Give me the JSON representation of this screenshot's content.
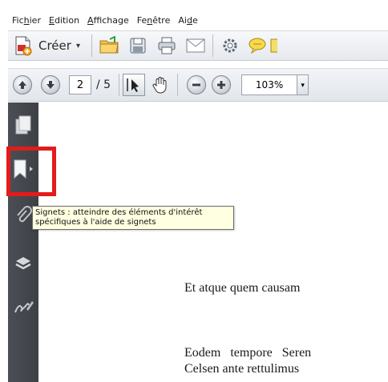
{
  "menu": {
    "items": [
      {
        "label_pre": "Fic",
        "label_u": "h",
        "label_post": "ier"
      },
      {
        "label_pre": "",
        "label_u": "E",
        "label_post": "dition"
      },
      {
        "label_pre": "",
        "label_u": "A",
        "label_post": "ffichage"
      },
      {
        "label_pre": "Fe",
        "label_u": "n",
        "label_post": "être"
      },
      {
        "label_pre": "Ai",
        "label_u": "d",
        "label_post": "e"
      }
    ]
  },
  "toolbar": {
    "create_label": "Créer",
    "create_caret": "▾"
  },
  "navbar": {
    "current_page": "2",
    "page_total": "/ 5",
    "zoom": "103%",
    "zoom_caret": "▾"
  },
  "tooltip": {
    "text": "Signets : atteindre des éléments d'intérêt spécifiques à l'aide de signets"
  },
  "document": {
    "line1": "Et atque quem causam",
    "line2": "Eodem   tempore   Seren",
    "line3": "Celsen ante rettulimus"
  },
  "colors": {
    "highlight": "#e31b1b",
    "tooltip_bg": "#ffffe1",
    "nav_bg": "#45494e"
  }
}
